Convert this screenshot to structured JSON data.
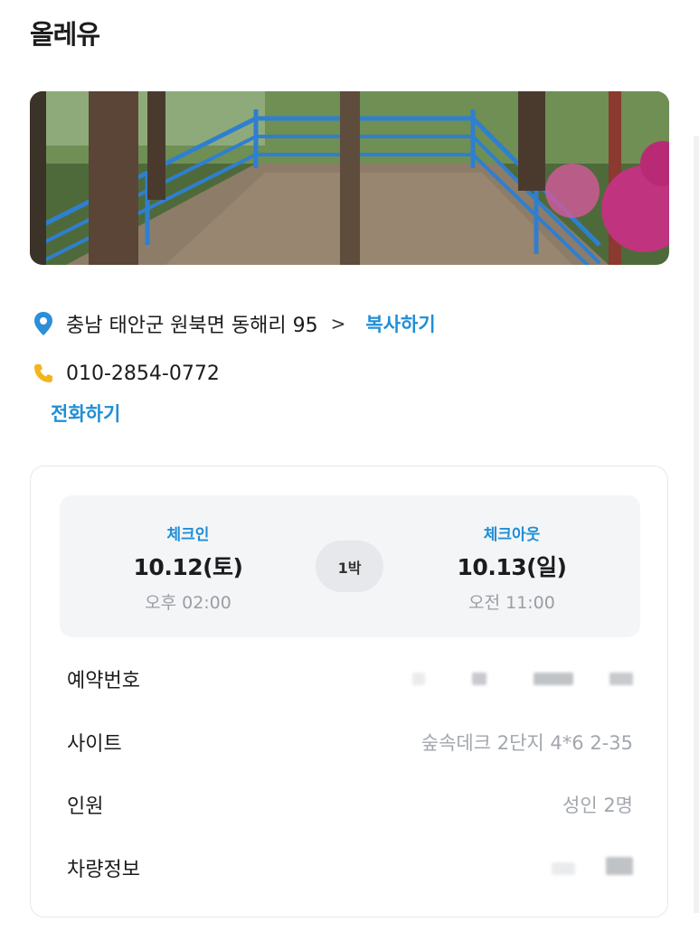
{
  "header": {
    "title": "올레유"
  },
  "photo": {
    "alt": ""
  },
  "address": {
    "text": "충남 태안군 원북면 동해리 95",
    "chevron": ">",
    "copy_label": "복사하기"
  },
  "phone": {
    "number": "010-2854-0772",
    "call_label": "전화하기"
  },
  "stay": {
    "checkin": {
      "label": "체크인",
      "date": "10.12(토)",
      "time": "오후 02:00"
    },
    "checkout": {
      "label": "체크아웃",
      "date": "10.13(일)",
      "time": "오전 11:00"
    },
    "nights": "1박"
  },
  "details": [
    {
      "label": "예약번호",
      "value": ""
    },
    {
      "label": "사이트",
      "value": "숲속데크 2단지 4*6 2-35"
    },
    {
      "label": "인원",
      "value": "성인 2명"
    },
    {
      "label": "차량정보",
      "value": ""
    }
  ],
  "colors": {
    "accent": "#1f8ed6",
    "pin": "#2b8fd9",
    "phone_icon": "#f2b51e",
    "muted": "#9a9ea3"
  }
}
